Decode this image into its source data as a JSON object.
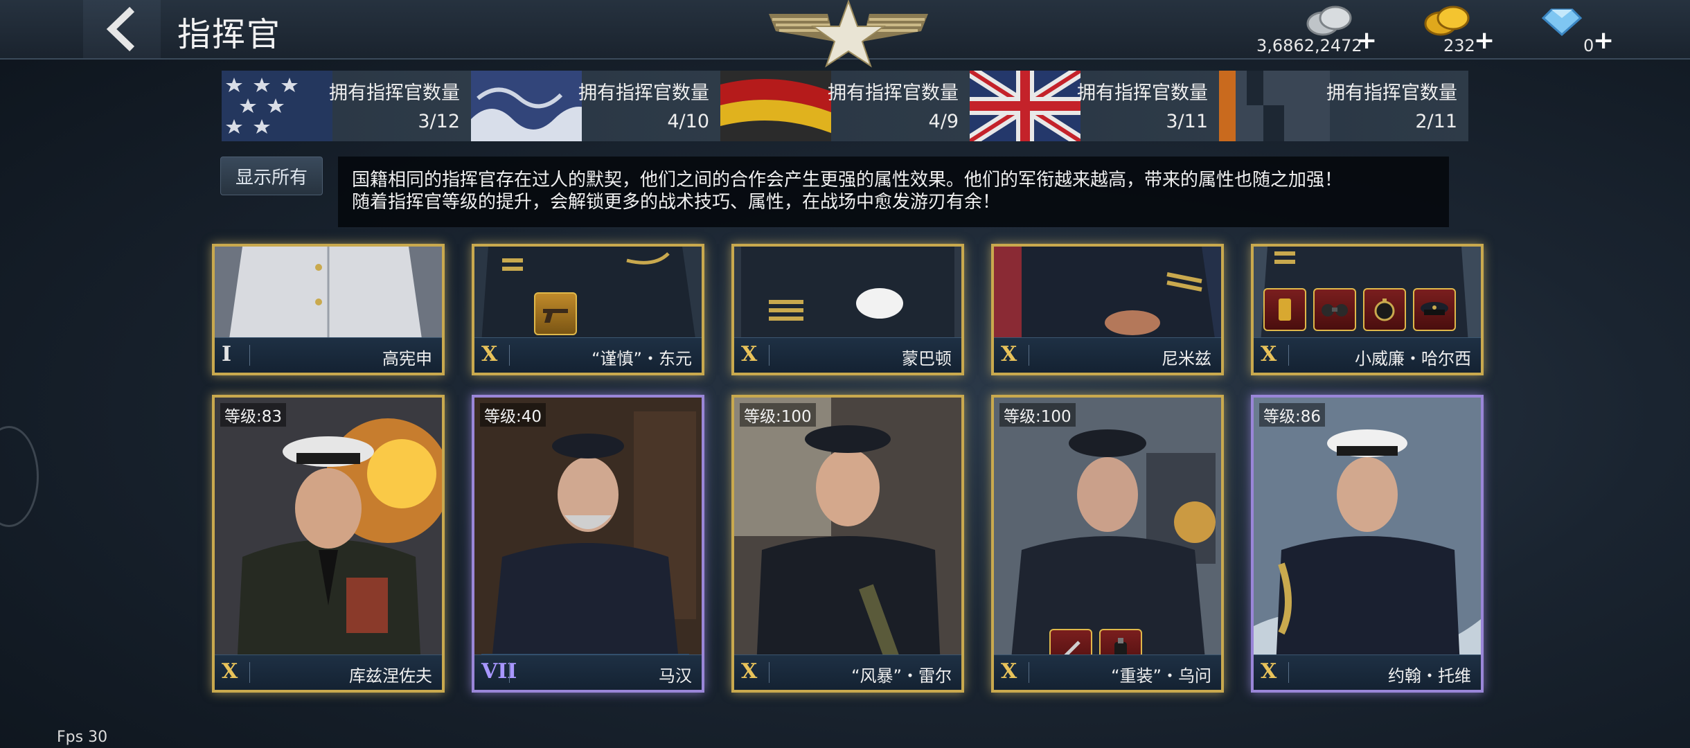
{
  "header": {
    "title": "指挥官",
    "silver": "3,6862,2472",
    "gold": "232",
    "diamond": "0",
    "plus": "+"
  },
  "nations": [
    {
      "label": "拥有指挥官数量",
      "count": "3/12",
      "flag": "usa"
    },
    {
      "label": "拥有指挥官数量",
      "count": "4/10",
      "flag": "japan"
    },
    {
      "label": "拥有指挥官数量",
      "count": "4/9",
      "flag": "germany"
    },
    {
      "label": "拥有指挥官数量",
      "count": "3/11",
      "flag": "uk"
    },
    {
      "label": "拥有指挥官数量",
      "count": "2/11",
      "flag": "other"
    }
  ],
  "show_all_label": "显示所有",
  "description": {
    "line1": "国籍相同的指挥官存在过人的默契，他们之间的合作会产生更强的属性效果。他们的军衔越来越高，带来的属性也随之加强！",
    "line2": "随着指挥官等级的提升，会解锁更多的战术技巧、属性，在战场中愈发游刃有余！"
  },
  "row1": [
    {
      "rank": "I",
      "name": "高宪申",
      "frame": "gold"
    },
    {
      "rank": "X",
      "name": "“谨慎”・东元",
      "frame": "gold"
    },
    {
      "rank": "X",
      "name": "蒙巴顿",
      "frame": "gold"
    },
    {
      "rank": "X",
      "name": "尼米兹",
      "frame": "gold"
    },
    {
      "rank": "X",
      "name": "小威廉・哈尔西",
      "frame": "gold"
    }
  ],
  "row2": [
    {
      "level": "等级:83",
      "rank": "X",
      "name": "库兹涅佐夫",
      "frame": "gold"
    },
    {
      "level": "等级:40",
      "rank": "VII",
      "name": "马汉",
      "frame": "purple"
    },
    {
      "level": "等级:100",
      "rank": "X",
      "name": "“风暴”・雷尔",
      "frame": "gold"
    },
    {
      "level": "等级:100",
      "rank": "X",
      "name": "“重装”・乌问",
      "frame": "gold"
    },
    {
      "level": "等级:86",
      "rank": "X",
      "name": "约翰・托维",
      "frame": "purple"
    }
  ],
  "fps": "Fps 30",
  "colors": {
    "gold_frame": "#c9a94e",
    "purple_frame": "#9a86d8",
    "rank_gold": "#e8c25a"
  }
}
